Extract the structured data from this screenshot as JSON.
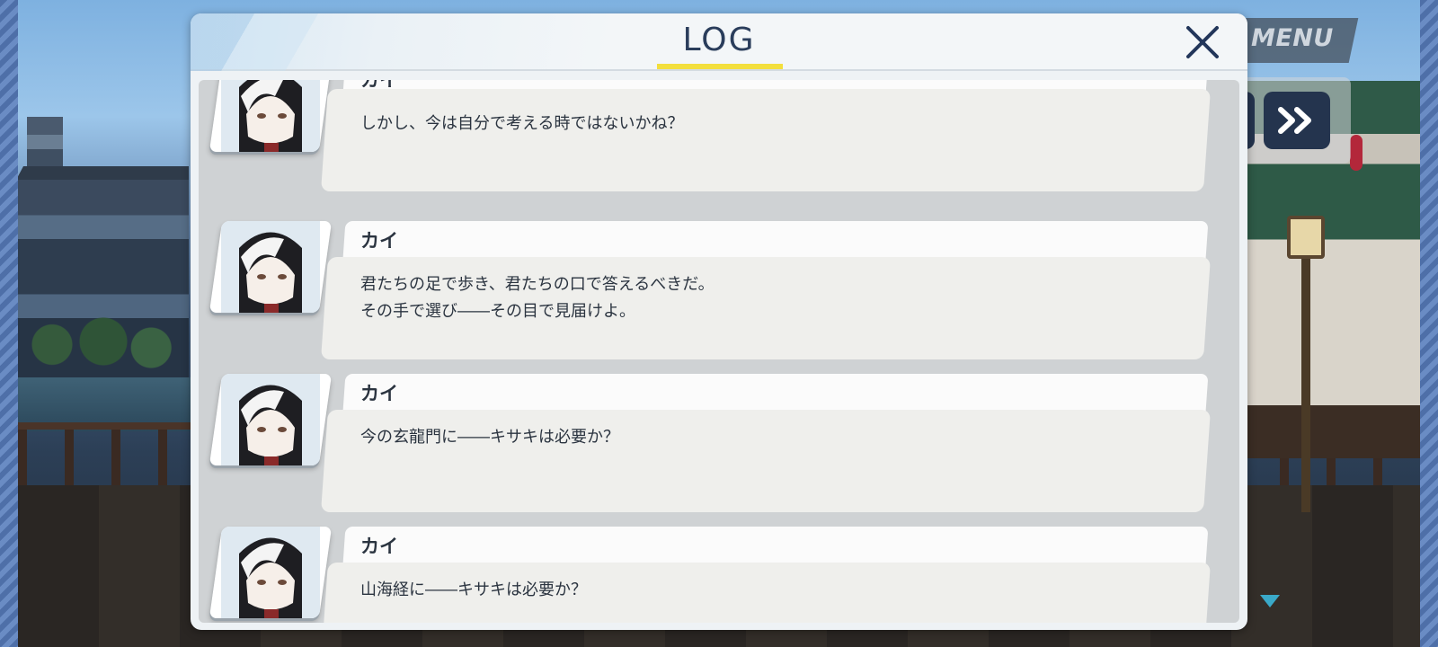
{
  "hud": {
    "menu_label": "MENU",
    "skip_icon": "fast-forward-icon",
    "scroll_indicator_icon": "triangle-down-icon"
  },
  "log_window": {
    "title": "LOG",
    "close_icon": "close-icon",
    "accent_color": "#f3df3d",
    "title_color": "#2a3d5b"
  },
  "entries": [
    {
      "speaker": "カイ",
      "lines": [
        "しかし、今は自分で考える時ではないかね？"
      ]
    },
    {
      "speaker": "カイ",
      "lines": [
        "君たちの足で歩き、君たちの口で答えるべきだ。",
        "その手で選び――その目で見届けよ。"
      ]
    },
    {
      "speaker": "カイ",
      "lines": [
        "今の玄龍門に――キサキは必要か？"
      ]
    },
    {
      "speaker": "カイ",
      "lines": [
        "山海経に――キサキは必要か？"
      ]
    }
  ]
}
